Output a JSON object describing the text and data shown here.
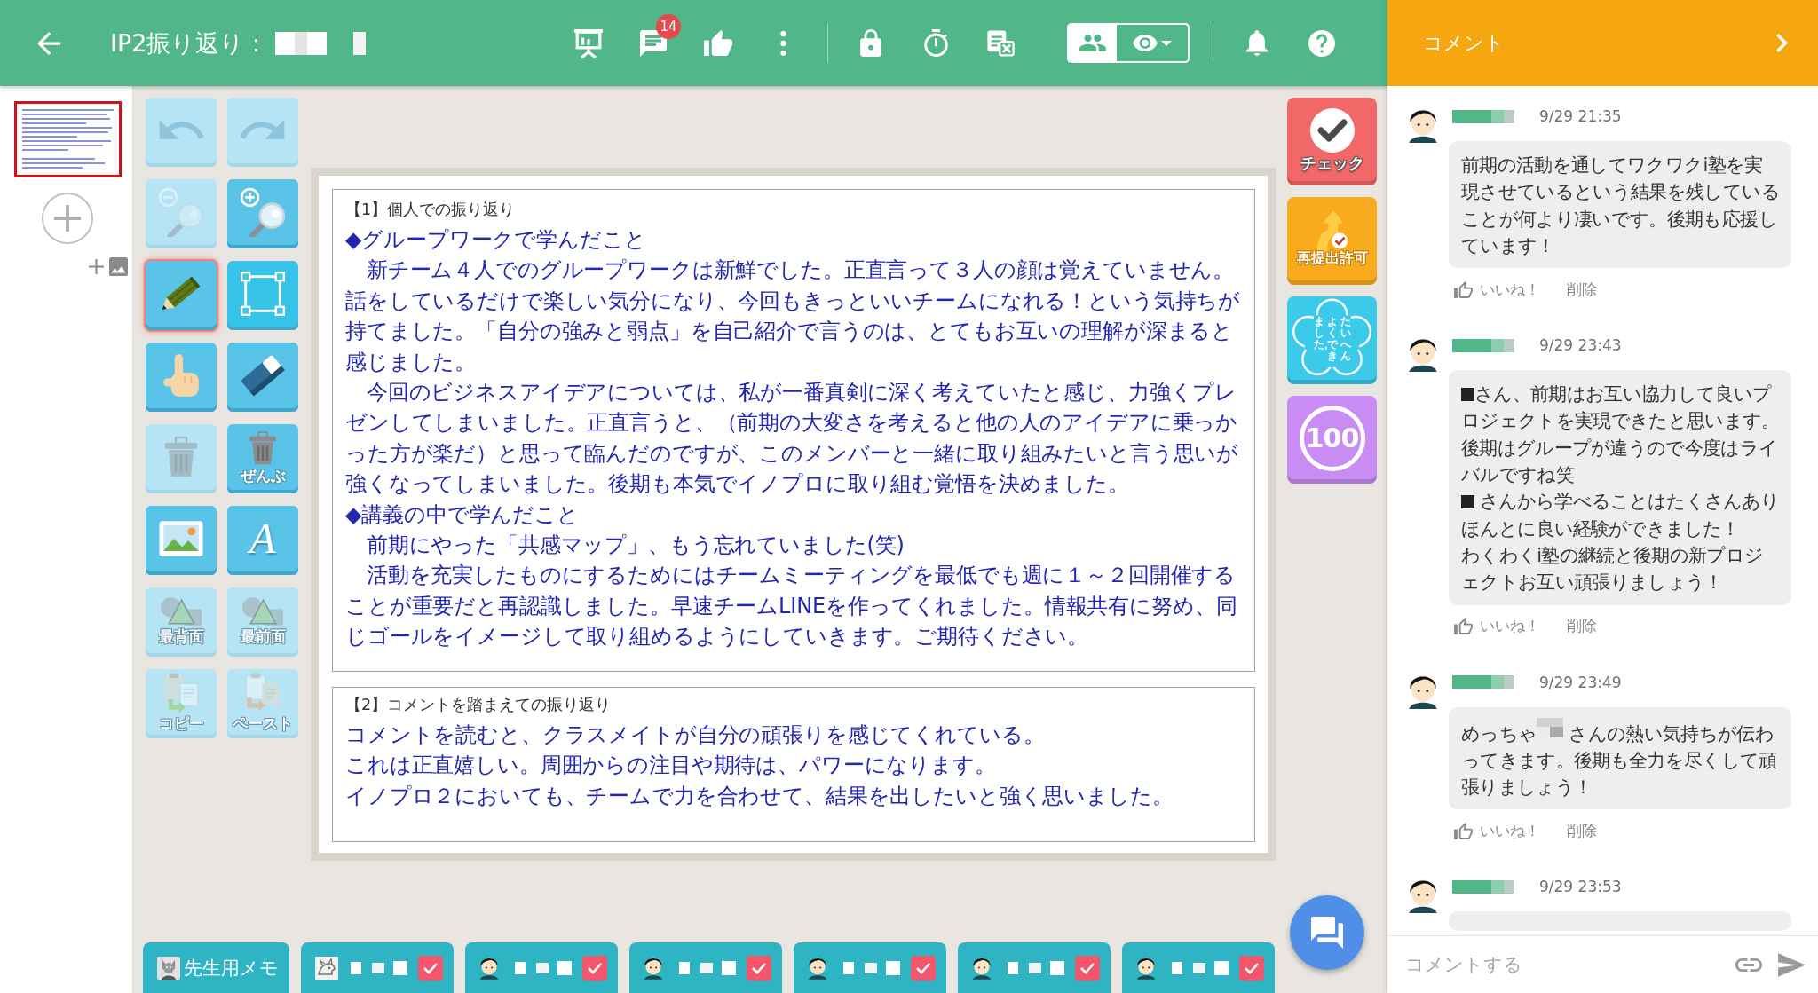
{
  "top_bar": {
    "title": "IP2振り返り：",
    "chat_badge": "14",
    "view_toggle": [
      {
        "kind": "group",
        "selected": true
      },
      {
        "kind": "visibility",
        "selected": false
      }
    ]
  },
  "pages": [
    {
      "selected": true
    }
  ],
  "tools": [
    {
      "kind": "undo",
      "disabled": true,
      "selected": false
    },
    {
      "kind": "redo",
      "disabled": true,
      "selected": false
    },
    {
      "kind": "zoom_out",
      "disabled": true,
      "selected": false
    },
    {
      "kind": "zoom_in",
      "disabled": false,
      "selected": false
    },
    {
      "kind": "pen",
      "disabled": false,
      "selected": true
    },
    {
      "kind": "select",
      "disabled": false,
      "selected": false
    },
    {
      "kind": "hand",
      "disabled": false,
      "selected": false
    },
    {
      "kind": "eraser",
      "disabled": false,
      "selected": false
    },
    {
      "kind": "delete",
      "disabled": true,
      "selected": false
    },
    {
      "kind": "delete_all",
      "label": "ぜんぶ",
      "disabled": false,
      "selected": false
    },
    {
      "kind": "image",
      "disabled": false,
      "selected": false
    },
    {
      "kind": "text",
      "label": "A",
      "disabled": false,
      "selected": false
    },
    {
      "kind": "to_back",
      "label": "最背面",
      "disabled": true,
      "selected": false
    },
    {
      "kind": "to_front",
      "label": "最前面",
      "disabled": true,
      "selected": false
    },
    {
      "kind": "copy",
      "label": "コピー",
      "disabled": true,
      "selected": false
    },
    {
      "kind": "paste",
      "label": "ペースト",
      "disabled": true,
      "selected": false
    }
  ],
  "document": {
    "sections": [
      {
        "heading": "【1】個人での振り返り",
        "paragraphs": [
          "◆グループワークで学んだこと",
          "　新チーム４人でのグループワークは新鮮でした。正直言って３人の顔は覚えていません。話をしているだけで楽しい気分になり、今回もきっといいチームになれる！という気持ちが持てました。「自分の強みと弱点」を自己紹介で言うのは、とてもお互いの理解が深まると感じました。",
          "　今回のビジネスアイデアについては、私が一番真剣に深く考えていたと感じ、力強くプレゼンしてしまいました。正直言うと、（前期の大変さを考えると他の人のアイデアに乗っかった方が楽だ）と思って臨んだのですが、このメンバーと一緒に取り組みたいと言う思いが強くなってしまいました。後期も本気でイノプロに取り組む覚悟を決めました。",
          "◆講義の中で学んだこと",
          "　前期にやった「共感マップ」、もう忘れていました(笑)",
          "　活動を充実したものにするためにはチームミーティングを最低でも週に１～２回開催することが重要だと再認識しました。早速チームLINEを作ってくれました。情報共有に努め、同じゴールをイメージして取り組めるようにしていきます。ご期待ください。"
        ]
      },
      {
        "heading": "【2】コメントを踏まえての振り返り",
        "paragraphs": [
          "コメントを読むと、クラスメイトが自分の頑張りを感じてくれている。",
          "これは正直嬉しい。周囲からの注目や期待は、パワーになります。",
          "イノプロ２においても、チームで力を合わせて、結果を出したいと強く思いました。"
        ]
      }
    ]
  },
  "stamps": [
    {
      "kind": "check",
      "label": "チェック",
      "color": "#f26767"
    },
    {
      "kind": "resubmit",
      "label": "再提出許可",
      "color": "#f9aa1d"
    },
    {
      "kind": "praise",
      "columns": [
        "ました。",
        "よくでき",
        "たいへん"
      ],
      "color": "#3ccaea"
    },
    {
      "kind": "score",
      "label": "100",
      "color": "#c98cf4"
    }
  ],
  "student_tabs": [
    {
      "kind": "memo",
      "label": "先生用メモ"
    },
    {
      "kind": "pet",
      "checked": true
    },
    {
      "kind": "student",
      "checked": true
    },
    {
      "kind": "student",
      "checked": true
    },
    {
      "kind": "student",
      "checked": true
    },
    {
      "kind": "student",
      "checked": true
    },
    {
      "kind": "student",
      "checked": true
    }
  ],
  "comment_panel": {
    "title": "コメント",
    "comments": [
      {
        "time": "9/29 21:35",
        "paragraphs": [
          [
            {
              "kind": "text",
              "text": "前期の活動を通してワクワクi塾を実現させているという結果を残していることが何より凄いです。後期も応援しています！"
            }
          ]
        ],
        "like": "いいね！",
        "delete": "削除"
      },
      {
        "time": "9/29 23:43",
        "paragraphs": [
          [
            {
              "kind": "blackout"
            },
            {
              "kind": "text",
              "text": "さん、前期はお互い協力して良いプロジェクトを実現できたと思います。"
            }
          ],
          [
            {
              "kind": "text",
              "text": "後期はグループが違うので今度はライバルですね笑"
            }
          ],
          [
            {
              "kind": "blackout"
            },
            {
              "kind": "text",
              "text": " さんから学べることはたくさんありほんとに良い経験ができました！"
            }
          ],
          [
            {
              "kind": "text",
              "text": "わくわくi塾の継続と後期の新プロジェクトお互い頑張りましょう！"
            }
          ]
        ],
        "like": "いいね！",
        "delete": "削除"
      },
      {
        "time": "9/29 23:49",
        "paragraphs": [
          [
            {
              "kind": "text",
              "text": "めっちゃ"
            },
            {
              "kind": "mosaic"
            },
            {
              "kind": "text",
              "text": " さんの熱い気持ちが伝わってきます。後期も全力を尽くして頑張りましょう！"
            }
          ]
        ],
        "like": "いいね！",
        "delete": "削除"
      },
      {
        "time": "9/29 23:53"
      }
    ],
    "input": {
      "placeholder": "コメントする"
    }
  }
}
